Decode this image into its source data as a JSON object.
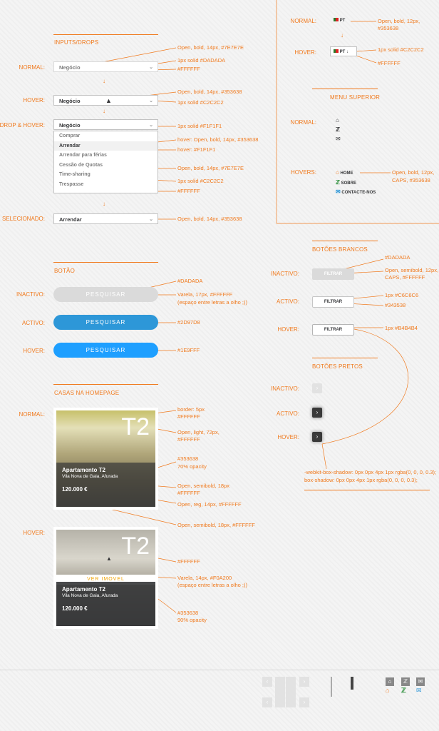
{
  "inputs": {
    "title": "INPUTS/DROPS",
    "labels": {
      "normal": "NORMAL:",
      "hover": "HOVER:",
      "drop_hover": "DROP & HOVER:",
      "selected": "SELECIONADO:"
    },
    "field_value": "Negócio",
    "selected_value": "Arrendar",
    "options": [
      "Comprar",
      "Arrendar",
      "Arrendar para férias",
      "Cessão de Quotas",
      "Time-sharing",
      "Trespasse"
    ],
    "notes": {
      "n1": "Open, bold, 14px, #7E7E7E",
      "n2": "1px solid #DADADA",
      "n3": "#FFFFFF",
      "h1": "Open, bold, 14px, #353638",
      "h2": "1px solid #C2C2C2",
      "d1": "1px solid #F1F1F1",
      "d2": "hover: Open, bold, 14px, #353638",
      "d3": "hover: #F1F1F1",
      "d4": "Open, bold, 14px, #7E7E7E",
      "d5": "1px solid #C2C2C2",
      "d6": "#FFFFFF",
      "s1": "Open, bold, 14px, #353638"
    }
  },
  "language": {
    "labels": {
      "normal": "NORMAL:",
      "hover": "HOVER:"
    },
    "code": "PT",
    "notes": {
      "n1": "Open, bold, 12px,",
      "n2": "#353638",
      "h1": "1px solid #C2C2C2",
      "h2": "#FFFFFF"
    }
  },
  "menu": {
    "title": "MENU SUPERIOR",
    "labels": {
      "normal": "NORMAL:",
      "hovers": "HOVERS:"
    },
    "items": [
      "HOME",
      "SOBRE",
      "CONTACTE-NOS"
    ],
    "notes": {
      "n1": "Open, bold, 12px,",
      "n2": "CAPS, #353638"
    }
  },
  "button": {
    "title": "BOTÃO",
    "labels": {
      "inactive": "INACTIVO:",
      "active": "ACTIVO:",
      "hover": "HOVER:"
    },
    "text": "PESQUISAR",
    "colors": {
      "inactive": "#DADADA",
      "active": "#2D97D8",
      "hover": "#1E9FFF"
    },
    "notes": {
      "i1": "#DADADA",
      "i2": "Varela, 17px, #FFFFFF",
      "i3": "(espaço entre letras a olho ;))",
      "a1": "#2D97D8",
      "h1": "#1E9FFF"
    }
  },
  "white_buttons": {
    "title": "BOTÕES BRANCOS",
    "labels": {
      "inactive": "INACTIVO:",
      "active": "ACTIVO:",
      "hover": "HOVER:"
    },
    "text": "FILTRAR",
    "notes": {
      "i1": "#DADADA",
      "i2": "Open, semibold, 12px,",
      "i3": "CAPS, #FFFFFF",
      "a1": "1px #C6C6C6",
      "a2": "#343538",
      "h1": "1px #B4B4B4"
    }
  },
  "black_buttons": {
    "title": "BOTÕES PRETOS",
    "labels": {
      "inactive": "INACTIVO:",
      "active": "ACTIVO:",
      "hover": "HOVER:"
    },
    "notes": {
      "s1": "-webkit-box-shadow:  0px 0px 4px 1px rgba(0, 0, 0, 0.3);",
      "s2": "box-shadow:  0px 0px 4px 1px rgba(0, 0, 0, 0.3);"
    }
  },
  "houses": {
    "title": "CASAS NA HOMEPAGE",
    "labels": {
      "normal": "NORMAL:",
      "hover": "HOVER:"
    },
    "big": "T2",
    "name": "Apartamento T2",
    "location": "Vila Nova de Gaia, Afurada",
    "price": "120.000 €",
    "cta": "VER IMOVEL",
    "notes": {
      "c1": "border: 5px",
      "c2": "#FFFFFF",
      "c3": "Open, light, 72px,",
      "c4": "#FFFFFF",
      "c5": "#353638",
      "c6": "70% opacity",
      "c7": "Open, semibold, 18px",
      "c8": "#FFFFFF",
      "c9": "Open, reg, 14px, #FFFFFF",
      "c10": "Open, semibold, 18px, #FFFFFF",
      "h1": "#FFFFFF",
      "h2": "Varela, 14px, #F0A200",
      "h3": "(espaço entre letras a olho ;))",
      "h4": "#353638",
      "h5": "90% opacity"
    }
  }
}
